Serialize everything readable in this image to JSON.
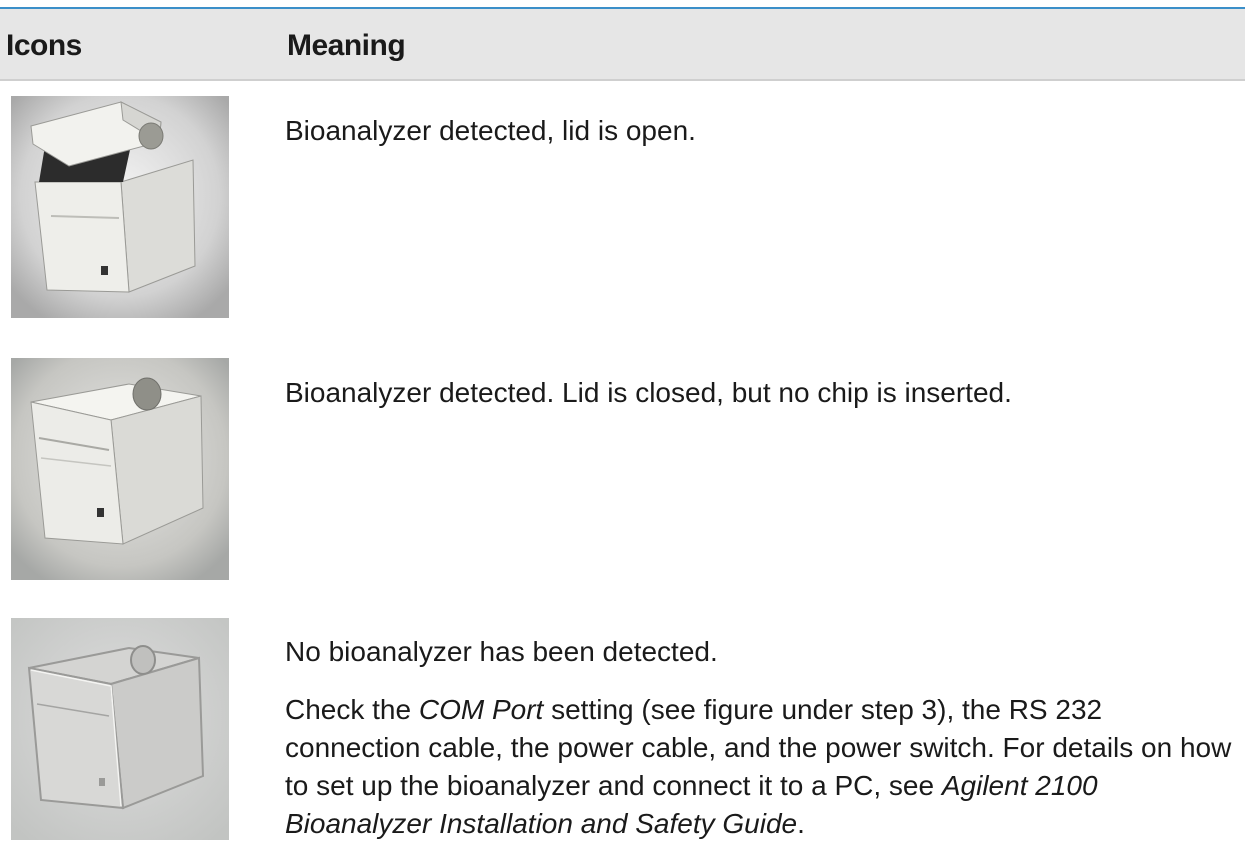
{
  "table": {
    "headers": {
      "icons": "Icons",
      "meaning": "Meaning"
    },
    "rows": [
      {
        "icon": "bioanalyzer-lid-open-icon",
        "text": "Bioanalyzer detected, lid is open."
      },
      {
        "icon": "bioanalyzer-lid-closed-icon",
        "text": "Bioanalyzer detected. Lid is closed, but no chip is inserted."
      },
      {
        "icon": "bioanalyzer-not-detected-icon",
        "text": "No bioanalyzer has been detected.",
        "details": {
          "part1": "Check the ",
          "em1": "COM Port",
          "part2": " setting (see figure under step 3), the RS 232 connection cable, the power cable, and the power switch. For details on how to set up the bioanalyzer and connect it to a PC, see ",
          "em2": "Agilent 2100 Bioanalyzer Installation and Safety Guide",
          "part3": "."
        }
      }
    ]
  }
}
